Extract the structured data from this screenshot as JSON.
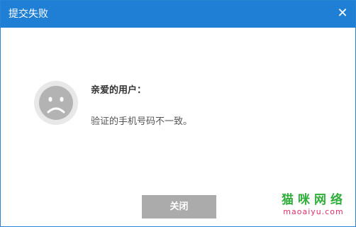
{
  "dialog": {
    "title": "提交失败",
    "close_icon": "close-x-icon",
    "icon": "sad-face-icon",
    "greeting": "亲爱的用户：",
    "message": "验证的手机号码不一致。",
    "close_button_label": "关闭"
  },
  "watermark": {
    "chinese": "猫咪网络",
    "url": "maoaiyu.com"
  },
  "colors": {
    "titlebar": "#1e7fd4",
    "button": "#ababab",
    "face_ring": "#e8e8e8",
    "face": "#b3b3b3",
    "watermark_green": "#2fae3a",
    "watermark_pink": "#e0306a"
  }
}
